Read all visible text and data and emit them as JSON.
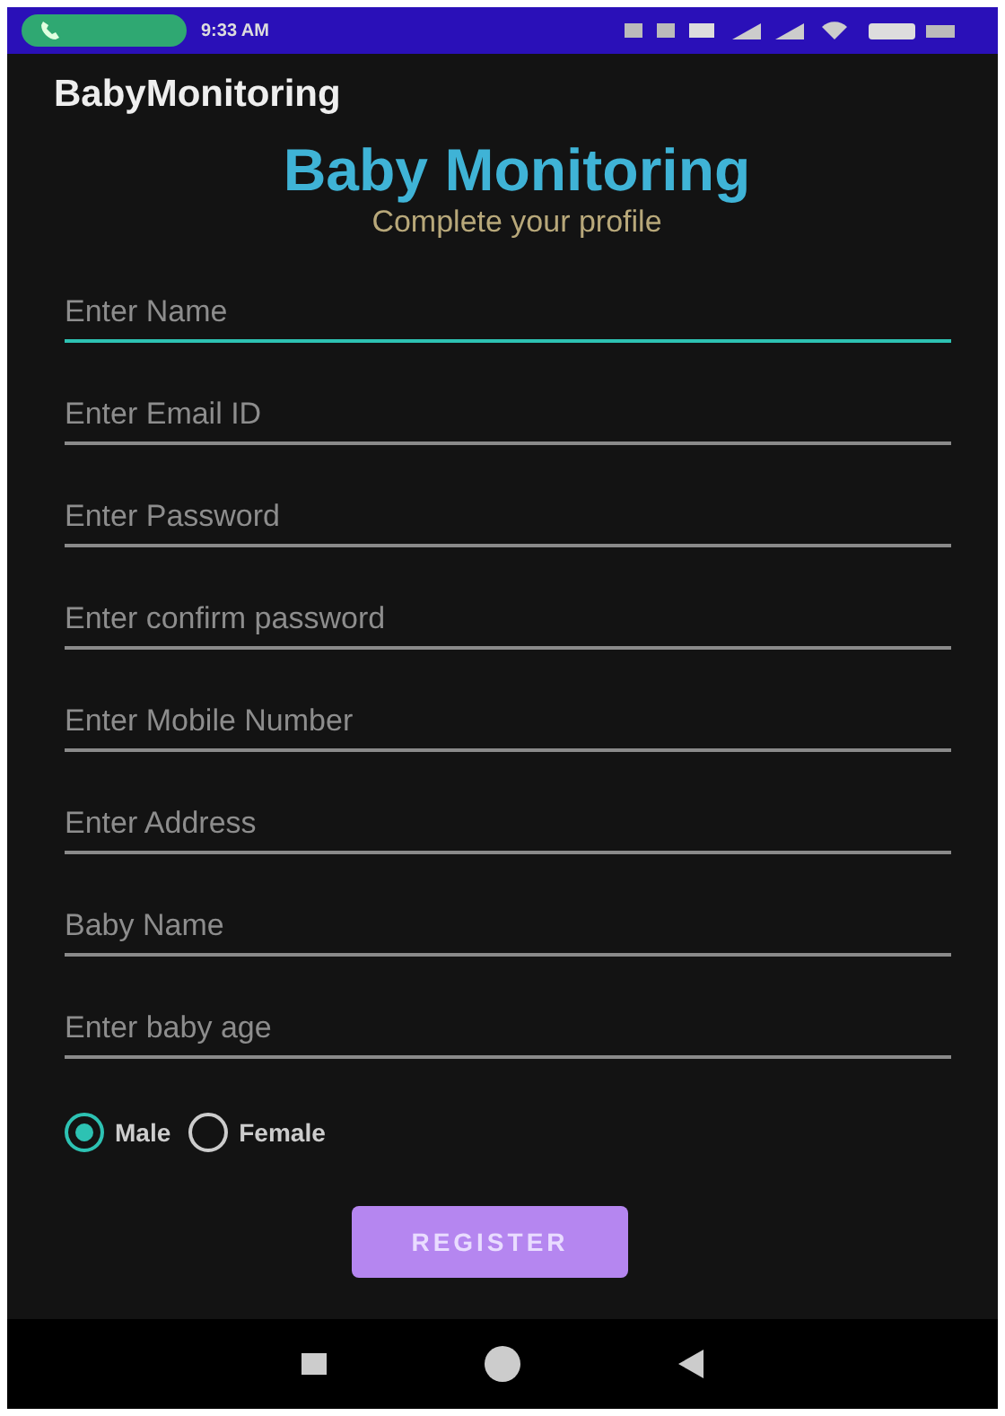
{
  "status_bar": {
    "time": "9:33 AM"
  },
  "app_bar": {
    "title": "BabyMonitoring"
  },
  "heading": "Baby Monitoring",
  "subtitle": "Complete your profile",
  "fields": [
    {
      "placeholder": "Enter Name",
      "focused": true
    },
    {
      "placeholder": "Enter Email ID",
      "focused": false
    },
    {
      "placeholder": "Enter Password",
      "focused": false
    },
    {
      "placeholder": "Enter confirm password",
      "focused": false
    },
    {
      "placeholder": "Enter Mobile Number",
      "focused": false
    },
    {
      "placeholder": "Enter Address",
      "focused": false
    },
    {
      "placeholder": "Baby Name",
      "focused": false
    },
    {
      "placeholder": "Enter baby age",
      "focused": false
    }
  ],
  "gender": [
    {
      "label": "Male",
      "selected": true
    },
    {
      "label": "Female",
      "selected": false
    }
  ],
  "register_button": "REGISTER"
}
